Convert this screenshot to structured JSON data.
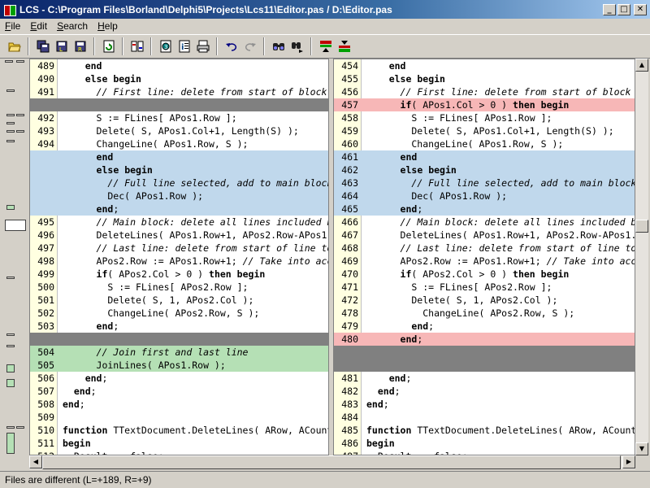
{
  "window": {
    "title": "LCS - C:\\Program Files\\Borland\\Delphi5\\Projects\\Lcs11\\Editor.pas / D:\\Editor.pas",
    "min_label": "_",
    "max_label": "□",
    "close_label": "✕"
  },
  "menu": [
    {
      "accel": "F",
      "rest": "ile"
    },
    {
      "accel": "E",
      "rest": "dit"
    },
    {
      "accel": "S",
      "rest": "earch"
    },
    {
      "accel": "H",
      "rest": "elp"
    }
  ],
  "toolbar": {
    "icons": [
      "open-folder-icon",
      "save-all-icon",
      "save-left-icon",
      "save-right-icon",
      "refresh-compare-icon",
      "swap-panes-icon",
      "options-icon",
      "info-icon",
      "print-icon",
      "undo-icon",
      "redo-icon",
      "find-icon",
      "find-next-icon",
      "prev-diff-icon",
      "next-diff-icon"
    ]
  },
  "colors": {
    "modified": "#c0d8ec",
    "added": "#b5e0b5",
    "changed": "#f7b7b7",
    "missing": "#808080",
    "gutter": "#ffffe1"
  },
  "left": {
    "lines": [
      {
        "n": "489",
        "t": "    end",
        "s": ""
      },
      {
        "n": "490",
        "t": "    else begin",
        "s": ""
      },
      {
        "n": "491",
        "t": "      // First line: delete from start of block",
        "s": ""
      },
      {
        "n": "",
        "t": "",
        "s": "gap"
      },
      {
        "n": "492",
        "t": "      S := FLines[ APos1.Row ];",
        "s": ""
      },
      {
        "n": "493",
        "t": "      Delete( S, APos1.Col+1, Length(S) );",
        "s": ""
      },
      {
        "n": "494",
        "t": "      ChangeLine( APos1.Row, S );",
        "s": ""
      },
      {
        "n": "",
        "t": "      end",
        "s": "diff"
      },
      {
        "n": "",
        "t": "      else begin",
        "s": "diff"
      },
      {
        "n": "",
        "t": "        // Full line selected, add to main block",
        "s": "diff"
      },
      {
        "n": "",
        "t": "        Dec( APos1.Row );",
        "s": "diff"
      },
      {
        "n": "",
        "t": "      end;",
        "s": "diff"
      },
      {
        "n": "495",
        "t": "      // Main block: delete all lines included b",
        "s": ""
      },
      {
        "n": "496",
        "t": "      DeleteLines( APos1.Row+1, APos2.Row-APos1.",
        "s": ""
      },
      {
        "n": "497",
        "t": "      // Last line: delete from start of line to",
        "s": ""
      },
      {
        "n": "498",
        "t": "      APos2.Row := APos1.Row+1; // Take into acc",
        "s": ""
      },
      {
        "n": "499",
        "t": "      if( APos2.Col > 0 ) then begin",
        "s": ""
      },
      {
        "n": "500",
        "t": "        S := FLines[ APos2.Row ];",
        "s": ""
      },
      {
        "n": "501",
        "t": "        Delete( S, 1, APos2.Col );",
        "s": ""
      },
      {
        "n": "502",
        "t": "        ChangeLine( APos2.Row, S );",
        "s": ""
      },
      {
        "n": "503",
        "t": "      end;",
        "s": ""
      },
      {
        "n": "",
        "t": "",
        "s": "gap"
      },
      {
        "n": "504",
        "t": "      // Join first and last line",
        "s": "add"
      },
      {
        "n": "505",
        "t": "      JoinLines( APos1.Row );",
        "s": "add"
      },
      {
        "n": "506",
        "t": "    end;",
        "s": ""
      },
      {
        "n": "507",
        "t": "  end;",
        "s": ""
      },
      {
        "n": "508",
        "t": "end;",
        "s": ""
      },
      {
        "n": "509",
        "t": "",
        "s": ""
      },
      {
        "n": "510",
        "t": "function TTextDocument.DeleteLines( ARow, ACount",
        "s": ""
      },
      {
        "n": "511",
        "t": "begin",
        "s": ""
      },
      {
        "n": "512",
        "t": "  Result := false;",
        "s": ""
      }
    ]
  },
  "right": {
    "lines": [
      {
        "n": "454",
        "t": "    end",
        "s": ""
      },
      {
        "n": "455",
        "t": "    else begin",
        "s": ""
      },
      {
        "n": "456",
        "t": "      // First line: delete from start of block",
        "s": ""
      },
      {
        "n": "457",
        "t": "      if( APos1.Col > 0 ) then begin",
        "s": "chg"
      },
      {
        "n": "458",
        "t": "        S := FLines[ APos1.Row ];",
        "s": ""
      },
      {
        "n": "459",
        "t": "        Delete( S, APos1.Col+1, Length(S) );",
        "s": ""
      },
      {
        "n": "460",
        "t": "        ChangeLine( APos1.Row, S );",
        "s": ""
      },
      {
        "n": "461",
        "t": "      end",
        "s": "diff"
      },
      {
        "n": "462",
        "t": "      else begin",
        "s": "diff"
      },
      {
        "n": "463",
        "t": "        // Full line selected, add to main block",
        "s": "diff"
      },
      {
        "n": "464",
        "t": "        Dec( APos1.Row );",
        "s": "diff"
      },
      {
        "n": "465",
        "t": "      end;",
        "s": "diff"
      },
      {
        "n": "466",
        "t": "      // Main block: delete all lines included b",
        "s": ""
      },
      {
        "n": "467",
        "t": "      DeleteLines( APos1.Row+1, APos2.Row-APos1.",
        "s": ""
      },
      {
        "n": "468",
        "t": "      // Last line: delete from start of line to",
        "s": ""
      },
      {
        "n": "469",
        "t": "      APos2.Row := APos1.Row+1; // Take into acc",
        "s": ""
      },
      {
        "n": "470",
        "t": "      if( APos2.Col > 0 ) then begin",
        "s": ""
      },
      {
        "n": "471",
        "t": "        S := FLines[ APos2.Row ];",
        "s": ""
      },
      {
        "n": "472",
        "t": "        Delete( S, 1, APos2.Col );",
        "s": ""
      },
      {
        "n": "478",
        "t": "          ChangeLine( APos2.Row, S );",
        "s": ""
      },
      {
        "n": "479",
        "t": "        end;",
        "s": ""
      },
      {
        "n": "480",
        "t": "      end;",
        "s": "chg"
      },
      {
        "n": "",
        "t": "",
        "s": "gap"
      },
      {
        "n": "",
        "t": "",
        "s": "gap"
      },
      {
        "n": "481",
        "t": "    end;",
        "s": ""
      },
      {
        "n": "482",
        "t": "  end;",
        "s": ""
      },
      {
        "n": "483",
        "t": "end;",
        "s": ""
      },
      {
        "n": "484",
        "t": "",
        "s": ""
      },
      {
        "n": "485",
        "t": "function TTextDocument.DeleteLines( ARow, ACount",
        "s": ""
      },
      {
        "n": "486",
        "t": "begin",
        "s": ""
      },
      {
        "n": "487",
        "t": "  Result := false;",
        "s": ""
      }
    ]
  },
  "status": {
    "text": "Files are different (L=+189, R=+9)"
  }
}
